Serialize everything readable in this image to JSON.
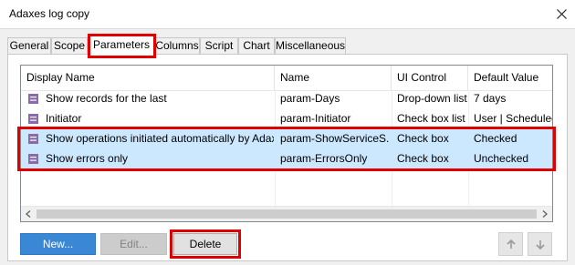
{
  "window": {
    "title": "Adaxes log copy"
  },
  "tabs": [
    {
      "label": "General",
      "active": false
    },
    {
      "label": "Scope",
      "active": false
    },
    {
      "label": "Parameters",
      "active": true
    },
    {
      "label": "Columns",
      "active": false
    },
    {
      "label": "Script",
      "active": false
    },
    {
      "label": "Chart",
      "active": false
    },
    {
      "label": "Miscellaneous",
      "active": false
    }
  ],
  "grid": {
    "columns": [
      "Display Name",
      "Name",
      "UI Control",
      "Default Value"
    ],
    "rows": [
      {
        "display_name": "Show records for the last",
        "name": "param-Days",
        "ui_control": "Drop-down list",
        "default_value": "7 days",
        "selected": false
      },
      {
        "display_name": "Initiator",
        "name": "param-Initiator",
        "ui_control": "Check box list",
        "default_value": "User | Scheduled T",
        "selected": false
      },
      {
        "display_name": "Show operations initiated automatically by Adaxes",
        "name": "param-ShowServiceS...",
        "ui_control": "Check box",
        "default_value": "Checked",
        "selected": true
      },
      {
        "display_name": "Show errors only",
        "name": "param-ErrorsOnly",
        "ui_control": "Check box",
        "default_value": "Unchecked",
        "selected": true
      }
    ]
  },
  "buttons": {
    "new_label": "New...",
    "edit_label": "Edit...",
    "delete_label": "Delete"
  },
  "icons": {
    "close": "close-icon",
    "parameter": "parameter-icon",
    "scroll_left": "scroll-left-icon",
    "scroll_right": "scroll-right-icon",
    "move_up": "arrow-up-icon",
    "move_down": "arrow-down-icon"
  },
  "colors": {
    "highlight": "#e00000",
    "selection": "#cce8ff",
    "primary_button": "#3a87d6",
    "parameter_icon": "#8a6aa8"
  }
}
